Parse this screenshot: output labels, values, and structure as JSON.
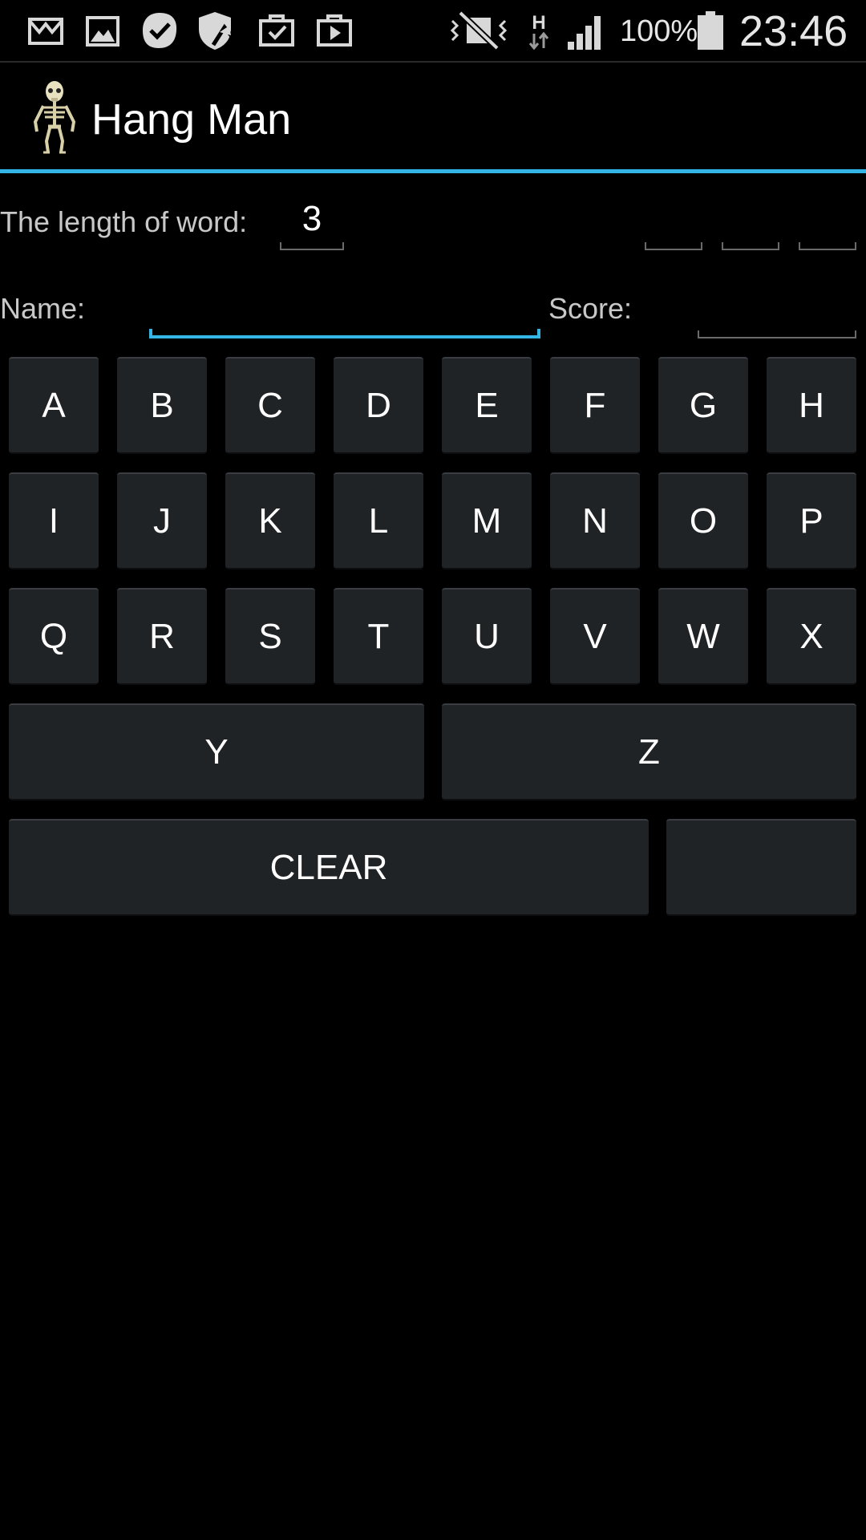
{
  "status_bar": {
    "icons": [
      "gmail-icon",
      "gallery-icon",
      "task-check-icon",
      "security-update-icon",
      "briefcase-check-icon",
      "briefcase-play-icon",
      "vibrate-mute-icon",
      "hspa-data-icon",
      "signal-strength-icon",
      "battery-icon"
    ],
    "network_type": "H",
    "battery_percent": "100%",
    "time": "23:46"
  },
  "action_bar": {
    "app_icon": "skeleton-icon",
    "title": "Hang Man",
    "accent_color": "#33b5e5"
  },
  "game": {
    "word_length_label": "The length of word:",
    "word_length_value": "3",
    "letter_slots": [
      "",
      "",
      ""
    ],
    "name_label": "Name:",
    "name_value": "",
    "score_label": "Score:",
    "score_value": ""
  },
  "keyboard": {
    "rows": [
      [
        "A",
        "B",
        "C",
        "D",
        "E",
        "F",
        "G",
        "H"
      ],
      [
        "I",
        "J",
        "K",
        "L",
        "M",
        "N",
        "O",
        "P"
      ],
      [
        "Q",
        "R",
        "S",
        "T",
        "U",
        "V",
        "W",
        "X"
      ],
      [
        "Y",
        "Z"
      ]
    ],
    "clear_label": "CLEAR",
    "blank_key_label": "",
    "key_color": "#202326"
  }
}
